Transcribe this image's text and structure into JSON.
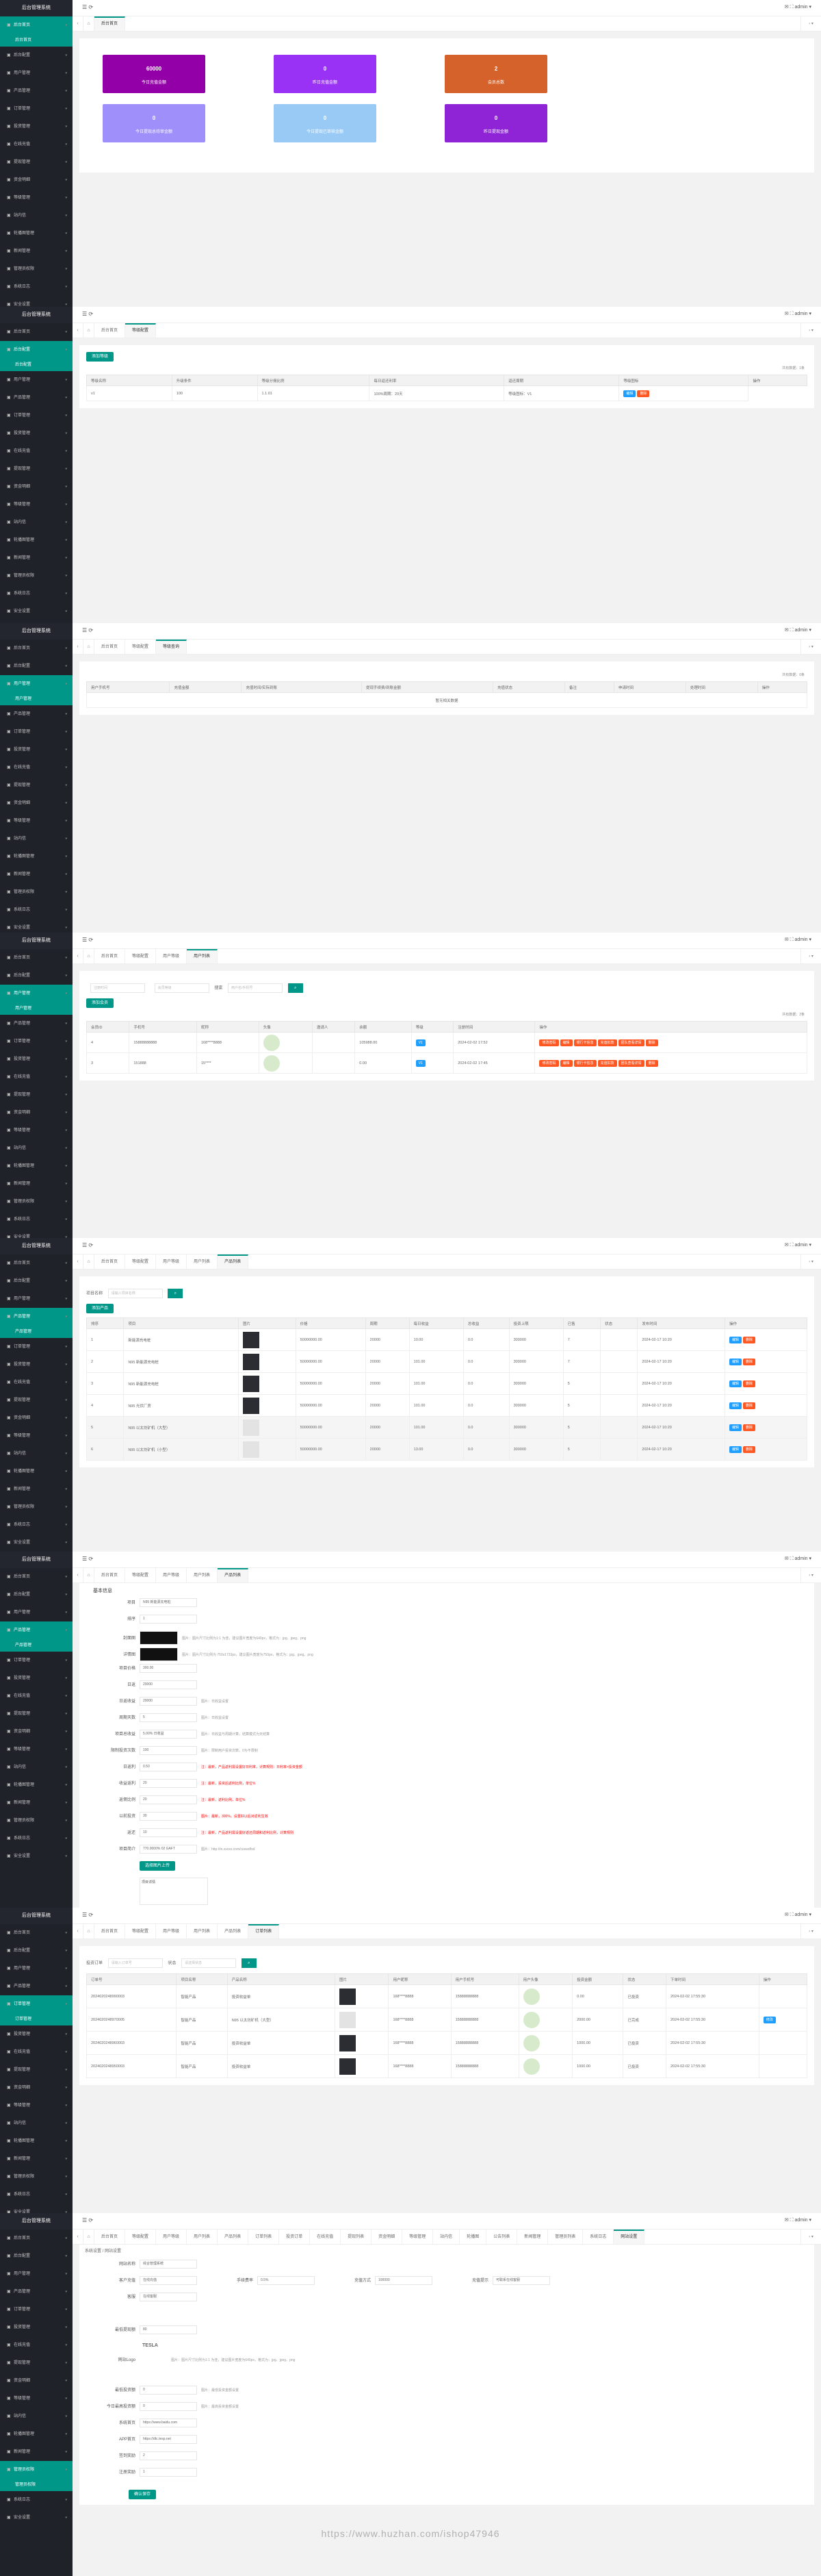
{
  "common": {
    "app_title": "后台管理系统",
    "user": "admin",
    "menu": [
      "后台首页",
      "后台配置",
      "用户管理",
      "产品管理",
      "订单管理",
      "投资管理",
      "在线充值",
      "提现管理",
      "资金明细",
      "等级管理",
      "站内信",
      "轮播图管理",
      "新闻管理",
      "管理员权限",
      "系统日志",
      "安全设置"
    ]
  },
  "s1": {
    "tabs": [
      "后台首页"
    ],
    "cards": [
      {
        "value": "60000",
        "label": "今日充值金额",
        "color": "#9400a8"
      },
      {
        "value": "0",
        "label": "昨日充值金额",
        "color": "#9932f5"
      },
      {
        "value": "2",
        "label": "会员总数",
        "color": "#d4622a"
      },
      {
        "value": "0",
        "label": "今日提现总待审金额",
        "color": "#9f8ffa"
      },
      {
        "value": "0",
        "label": "今日提现已审核金额",
        "color": "#99caf5"
      },
      {
        "value": "0",
        "label": "昨日提现金额",
        "color": "#8e24d6"
      }
    ]
  },
  "s2": {
    "tabs": [
      "后台首页",
      "等级配置"
    ],
    "add": "添加等级",
    "count": "共有数据：1条",
    "headers": [
      "等级名称",
      "升级条件",
      "等级分佣比例",
      "每日返还利率",
      "返还周期",
      "等级图标",
      "操作"
    ],
    "row": [
      "v1",
      "100",
      "1.1.01",
      "100%周期：20天",
      "等级图标：V1"
    ],
    "ops": [
      "编辑",
      "删除"
    ]
  },
  "s3": {
    "tabs": [
      "后台首页",
      "等级配置",
      "等级查询"
    ],
    "count": "共有数据：0条",
    "headers": [
      "用户手机号",
      "充值金额",
      "充值时间/实际到账",
      "提现手续费/到账金额",
      "充值状态",
      "备注",
      "申请时间",
      "处理时间",
      "操作"
    ],
    "empty": "暂无相关数据"
  },
  "s4": {
    "tabs": [
      "后台首页",
      "等级配置",
      "用户等级",
      "用户列表"
    ],
    "filters": [
      "注册时间",
      "会员等级",
      "搜索",
      "用户名/手机号"
    ],
    "add": "添加会员",
    "count": "共有数据：2条",
    "headers": [
      "会员ID",
      "手机号",
      "昵称",
      "头像",
      "邀请人",
      "余额",
      "等级",
      "注册时间",
      "操作"
    ],
    "rows": [
      [
        "4",
        "15888888888",
        "168****8888",
        "",
        "105988.00",
        "V1",
        "2024-02-02 17:52"
      ],
      [
        "3",
        "151888",
        "15****",
        "",
        "0.00",
        "V1",
        "2024-02-02 17:45"
      ]
    ],
    "ops": [
      "修改密码",
      "编辑",
      "银行卡信息",
      "充值扣款",
      "团队查看详情",
      "删除"
    ]
  },
  "s5": {
    "tabs": [
      "后台首页",
      "等级配置",
      "用户等级",
      "用户列表",
      "产品列表"
    ],
    "search_label": "项目名称",
    "search_ph": "请输入项目名称",
    "add": "添加产品",
    "headers": [
      "排序",
      "项目",
      "图片",
      "价格",
      "周期",
      "每日收益",
      "总收益",
      "投资上限",
      "已售",
      "状态",
      "发布时间",
      "操作"
    ],
    "rows": [
      [
        "1",
        "新能源充电桩",
        "50000000.00",
        "20000",
        "10.00",
        "0.0",
        "300000",
        "7",
        "2024-02-17 10:20"
      ],
      [
        "2",
        "N95 新能源充电桩",
        "50000000.00",
        "20000",
        "101.00",
        "0.0",
        "300000",
        "7",
        "2024-02-17 10:20"
      ],
      [
        "3",
        "N95 新能源充电桩",
        "50000000.00",
        "20000",
        "101.00",
        "0.0",
        "300000",
        "5",
        "2024-02-17 10:20"
      ],
      [
        "4",
        "N95 光伏厂房",
        "50000000.00",
        "20000",
        "101.00",
        "0.0",
        "300000",
        "5",
        "2024-02-17 10:20"
      ],
      [
        "5",
        "N95 以太坊矿机（大型）",
        "50000000.00",
        "20000",
        "101.00",
        "0.0",
        "300000",
        "5",
        "2024-02-17 10:20"
      ],
      [
        "6",
        "N95 以太坊矿机（小型）",
        "50000000.00",
        "20000",
        "13.00",
        "0.0",
        "300000",
        "5",
        "2024-02-17 10:20"
      ]
    ],
    "ops": [
      "编辑",
      "删除"
    ]
  },
  "s6": {
    "tabs": [
      "后台首页",
      "等级配置",
      "用户等级",
      "用户列表",
      "产品列表"
    ],
    "section": "基本信息",
    "fields": [
      {
        "label": "项目",
        "value": "N95 新能源充电桩",
        "tip": ""
      },
      {
        "label": "排序",
        "value": "1",
        "tip": ""
      },
      {
        "label": "封面图",
        "value": "",
        "tip": "图片：图片尺寸比例为1:1 为佳，建议图片宽度为640px，格式为：jpg、jpeg、png"
      },
      {
        "label": "详情图",
        "value": "",
        "tip": "图片：图片尺寸比例为 750x1733px，建议图片宽度为750px，格式为：jpg、jpeg、png"
      },
      {
        "label": "项目价格",
        "value": "300.00",
        "tip": ""
      },
      {
        "label": "日返",
        "value": "20000",
        "tip": ""
      },
      {
        "label": "日返收益",
        "value": "20000",
        "tip": "图片：日收益设置"
      },
      {
        "label": "周期天数",
        "value": "5",
        "tip": "图片：日收益设置"
      },
      {
        "label": "项目总收益",
        "value": "5.00% 日收益",
        "tip": "图片：日收益与周期计算，结算模式为天结算"
      },
      {
        "label": "限制投资次数",
        "value": "100",
        "tip": "图片：限制用户投资次数，0为不限制"
      },
      {
        "label": "日返利",
        "value": "0.50",
        "tip": "注：最新，产品返利需设置好日利率，计算规则：日利率×投资金额"
      },
      {
        "label": "收益返利",
        "value": "20",
        "tip": "注：最新，投资后返利比例，单位%"
      },
      {
        "label": "返佣比例",
        "value": "20",
        "tip": "注：最新，返利比例，单位%"
      },
      {
        "label": "以前投资",
        "value": "30",
        "tip": "图片：最新，300%，设置好以后对返利生效"
      },
      {
        "label": "返还",
        "value": "10",
        "tip": "注：最新，产品返利需设置好返还周期和返利比例，计算规则"
      },
      {
        "label": "项目简介",
        "value": "770.0000% 02 GAFT",
        "tip": "图片：http://in.xxxxx.com/ceswdfsd"
      }
    ],
    "upload": "选择图片上传",
    "detail_label": "项目详情"
  },
  "s7": {
    "tabs": [
      "后台首页",
      "等级配置",
      "用户等级",
      "用户列表",
      "产品列表",
      "订单列表"
    ],
    "filters": [
      "投资订单",
      "请输入订单号",
      "状态",
      "请选择状态"
    ],
    "headers": [
      "订单号",
      "项目名称",
      "产品名称",
      "图片",
      "用户昵称",
      "用户手机号",
      "用户头像",
      "投资金额",
      "状态",
      "下单时间",
      "操作"
    ],
    "rows": [
      [
        "2024020248990003",
        "智能产品",
        "投资收益单",
        "168****8888",
        "15888888888",
        "0.00",
        "已投资",
        "2024-02-02 17:55:30"
      ],
      [
        "2024020248970005",
        "智能产品",
        "N95 以太坊矿机（大型）",
        "168****8888",
        "15888888888",
        "2000.00",
        "已完成",
        "2024-02-02 17:55:30"
      ],
      [
        "2024020248960003",
        "智能产品",
        "投资收益单",
        "168****8888",
        "15888888888",
        "1000.00",
        "已投资",
        "2024-02-02 17:55:30"
      ],
      [
        "2024020248950003",
        "智能产品",
        "投资收益单",
        "168****8888",
        "15888888888",
        "1000.00",
        "已投资",
        "2024-02-02 17:55:30"
      ]
    ],
    "op": "修改"
  },
  "s8": {
    "tabs": [
      "后台首页",
      "等级配置",
      "用户等级",
      "用户列表",
      "产品列表",
      "订单列表",
      "投资订单",
      "在线充值",
      "提现列表",
      "资金明细",
      "等级管理",
      "站内信",
      "轮播图",
      "公告列表",
      "新闻管理",
      "管理员列表",
      "系统日志",
      "网站设置"
    ],
    "breadcrumb": [
      "系统设置",
      "网站设置"
    ],
    "fields": [
      {
        "label": "网站名称",
        "value": "综合管理系统",
        "tip": ""
      },
      {
        "label": "客服",
        "value": "在线客服",
        "tip": ""
      },
      {
        "label": "最低提现额",
        "value": "80",
        "tip": ""
      },
      {
        "label": "网站Logo",
        "value": "TESLA",
        "tip": "图片：图片尺寸比例为1:1 为佳，建议图片宽度为640px，格式为：jpg、jpeg、png"
      },
      {
        "label": "最低投资额",
        "value": "0",
        "tip": "图片：最低投资金额设置"
      },
      {
        "label": "今日最高投资额",
        "value": "0",
        "tip": "图片：最高投资金额设置"
      },
      {
        "label": "系统首页",
        "value": "https://www.baidu.com",
        "tip": ""
      },
      {
        "label": "APP首页",
        "value": "https://dtc.tesp.net",
        "tip": ""
      },
      {
        "label": "签到奖励",
        "value": "2",
        "tip": ""
      },
      {
        "label": "注册奖励",
        "value": "1",
        "tip": ""
      }
    ],
    "extra": [
      {
        "label": "客户充值",
        "value": "在线充值",
        "k2": "手续费率",
        "v2": "0.5%"
      },
      {
        "label": "充值方式",
        "value": "100000"
      },
      {
        "label": "充值提示",
        "value": "可联系在线客服"
      }
    ],
    "save": "确认保存"
  },
  "watermark": "https://www.huzhan.com/ishop47946"
}
